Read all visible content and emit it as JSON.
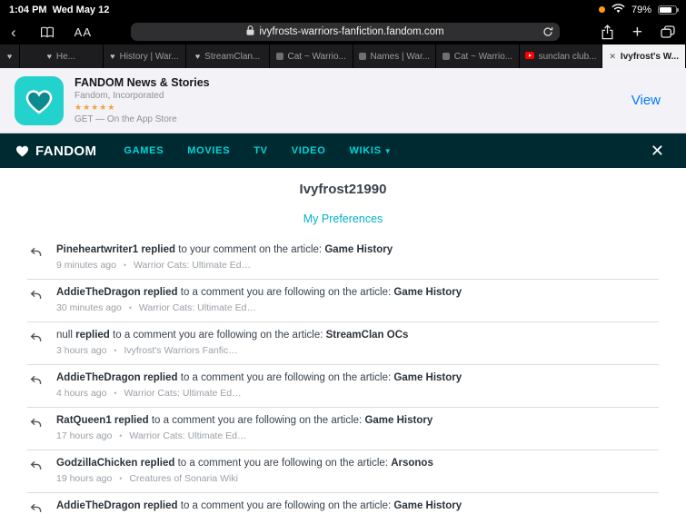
{
  "status_bar": {
    "time": "1:04 PM",
    "date": "Wed May 12",
    "battery_percent": "79%"
  },
  "toolbar": {
    "reader_button": "AA",
    "url": "ivyfrosts-warriors-fanfiction.fandom.com"
  },
  "tab_bar": {
    "tabs": [
      {
        "title": ""
      },
      {
        "title": "He..."
      },
      {
        "title": "History | War..."
      },
      {
        "title": "StreamClan..."
      },
      {
        "title": "Cat ~ Warrio..."
      },
      {
        "title": "Names | War..."
      },
      {
        "title": "Cat ~ Warrio..."
      },
      {
        "title": "sunclan club..."
      },
      {
        "title": "Ivyfrost's W..."
      }
    ],
    "close_glyph": "✕"
  },
  "app_banner": {
    "app_name": "FANDOM News & Stories",
    "developer": "Fandom, Incorporated",
    "stars": "★★★★★",
    "tagline": "GET — On the App Store",
    "view_button": "View"
  },
  "nav": {
    "brand": "FANDOM",
    "items": [
      "GAMES",
      "MOVIES",
      "TV",
      "VIDEO",
      "WIKIS"
    ],
    "close_glyph": "✕"
  },
  "page": {
    "title": "Ivyfrost21990",
    "preferences_link": "My Preferences",
    "bullet": "•",
    "notifications": [
      {
        "user": "Pineheartwriter1",
        "action": "replied",
        "middle": "to your comment on the article:",
        "article": "Game History",
        "time": "9 minutes ago",
        "wiki": "Warrior Cats: Ultimate Ed…"
      },
      {
        "user": "AddieTheDragon",
        "action": "replied",
        "middle": "to a comment you are following on the article:",
        "article": "Game History",
        "time": "30 minutes ago",
        "wiki": "Warrior Cats: Ultimate Ed…"
      },
      {
        "user": "null",
        "action": "replied",
        "middle": "to a comment you are following on the article:",
        "article": "StreamClan OCs",
        "time": "3 hours ago",
        "wiki": "Ivyfrost's Warriors Fanfic…"
      },
      {
        "user": "AddieTheDragon",
        "action": "replied",
        "middle": "to a comment you are following on the article:",
        "article": "Game History",
        "time": "4 hours ago",
        "wiki": "Warrior Cats: Ultimate Ed…"
      },
      {
        "user": "RatQueen1",
        "action": "replied",
        "middle": "to a comment you are following on the article:",
        "article": "Game History",
        "time": "17 hours ago",
        "wiki": "Warrior Cats: Ultimate Ed…"
      },
      {
        "user": "GodzillaChicken",
        "action": "replied",
        "middle": "to a comment you are following on the article:",
        "article": "Arsonos",
        "time": "19 hours ago",
        "wiki": "Creatures of Sonaria Wiki"
      },
      {
        "user": "AddieTheDragon",
        "action": "replied",
        "middle": "to a comment you are following on the article:",
        "article": "Game History",
        "time": "",
        "wiki": ""
      }
    ]
  }
}
